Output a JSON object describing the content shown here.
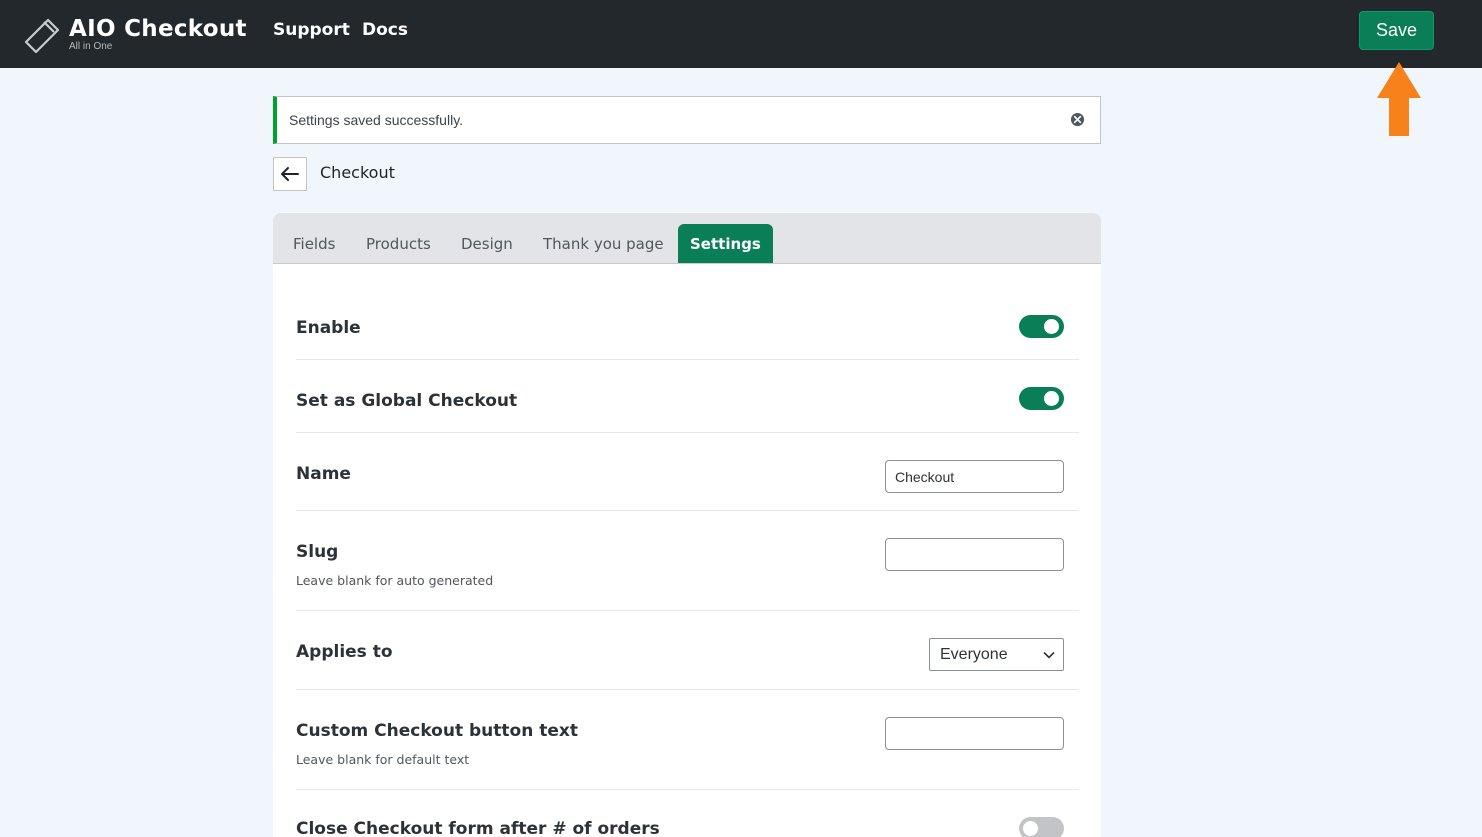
{
  "header": {
    "brand_name": "AIO Checkout",
    "brand_tagline": "All in One",
    "nav": [
      {
        "label": "Support"
      },
      {
        "label": "Docs"
      }
    ],
    "save_label": "Save"
  },
  "notice": {
    "message": "Settings saved successfully.",
    "type": "success",
    "accent_color": "#00a32a"
  },
  "page": {
    "title": "Checkout"
  },
  "tabs": [
    {
      "label": "Fields",
      "active": false
    },
    {
      "label": "Products",
      "active": false
    },
    {
      "label": "Design",
      "active": false
    },
    {
      "label": "Thank you page",
      "active": false
    },
    {
      "label": "Settings",
      "active": true
    }
  ],
  "settings": {
    "enable": {
      "label": "Enable",
      "value": true
    },
    "global_checkout": {
      "label": "Set as Global Checkout",
      "value": true
    },
    "name": {
      "label": "Name",
      "value": "Checkout"
    },
    "slug": {
      "label": "Slug",
      "description": "Leave blank for auto generated",
      "value": ""
    },
    "applies_to": {
      "label": "Applies to",
      "value": "Everyone"
    },
    "button_text": {
      "label": "Custom Checkout button text",
      "description": "Leave blank for default text",
      "value": ""
    },
    "close_after_orders": {
      "label": "Close Checkout form after # of orders",
      "value": false
    }
  },
  "colors": {
    "accent": "#0a7e57",
    "topbar": "#23282d",
    "annotation_arrow": "#f7821b"
  },
  "icons": {
    "logo": "tag-icon",
    "back": "arrow-left-icon",
    "dismiss": "close-circle-icon",
    "dropdown": "chevron-down-icon",
    "annotation": "arrow-up-icon"
  }
}
